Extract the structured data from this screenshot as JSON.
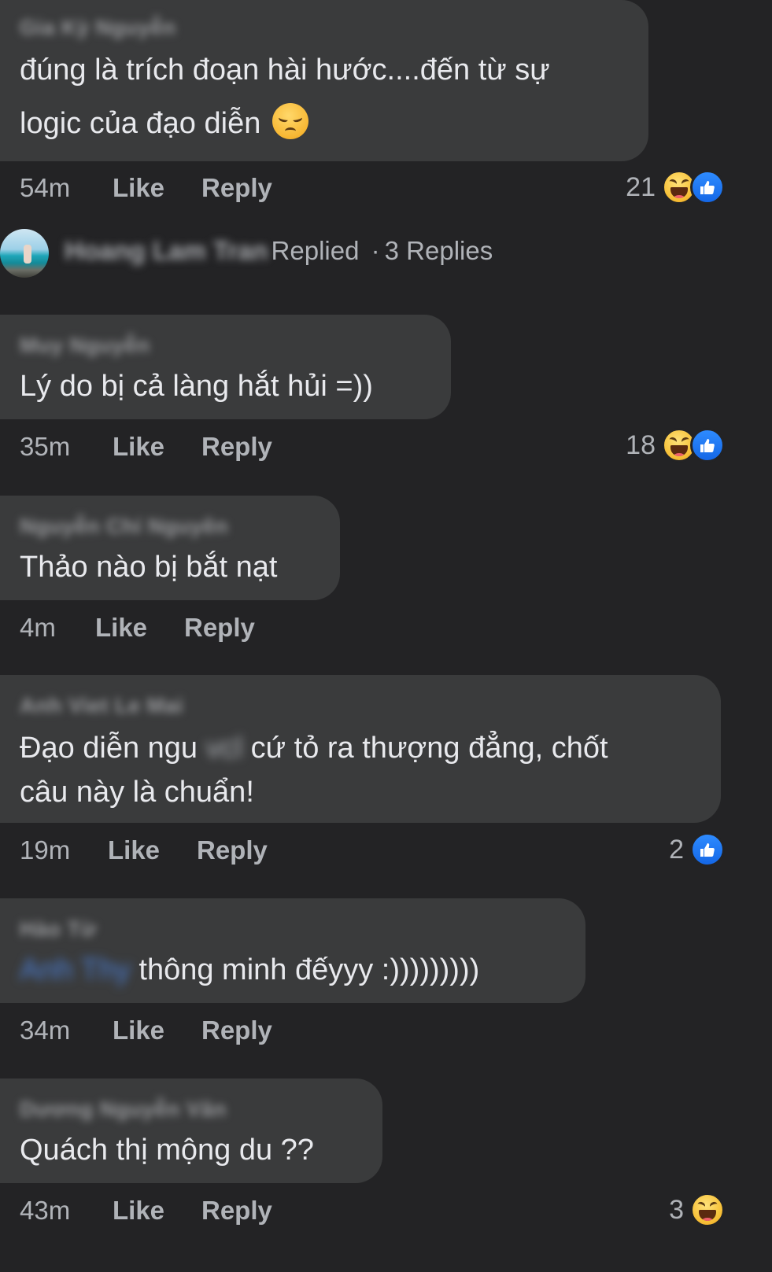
{
  "comments": [
    {
      "author": "Gia Kỳ Nguyễn",
      "lines": [
        "đúng là trích đoạn hài hước....đến từ sự",
        "logic của đạo diễn"
      ],
      "emoji": "disappointed-face-icon",
      "time": "54m",
      "like_label": "Like",
      "reply_label": "Reply",
      "reaction_count": "21",
      "reactions": [
        "haha-icon",
        "like-icon"
      ]
    },
    {
      "author": "Muy Nguyễn",
      "lines": [
        "Lý do bị cả làng hắt hủi =))"
      ],
      "time": "35m",
      "like_label": "Like",
      "reply_label": "Reply",
      "reaction_count": "18",
      "reactions": [
        "haha-icon",
        "like-icon"
      ]
    },
    {
      "author": "Nguyễn Chí Nguyên",
      "lines": [
        "Thảo nào bị bắt nạt"
      ],
      "time": "4m",
      "like_label": "Like",
      "reply_label": "Reply"
    },
    {
      "author": "Anh Viet Le Mai",
      "line1_start": "Đạo diễn ngu",
      "line1_censored": "vcl",
      "line1_end": "cứ tỏ ra thượng đẳng, chốt",
      "line2": "câu này là chuẩn!",
      "time": "19m",
      "like_label": "Like",
      "reply_label": "Reply",
      "reaction_count": "2",
      "reactions": [
        "like-icon"
      ]
    },
    {
      "author": "Hào Từ",
      "mention": "Anh Thy",
      "text": "thông minh đếyyy :)))))))))",
      "time": "34m",
      "like_label": "Like",
      "reply_label": "Reply"
    },
    {
      "author": "Dương Nguyễn Văn",
      "lines": [
        "Quách thị mộng du ??"
      ],
      "time": "43m",
      "like_label": "Like",
      "reply_label": "Reply",
      "reaction_count": "3",
      "reactions": [
        "haha-icon"
      ]
    }
  ],
  "replies_row": {
    "name": "Hoang Lam Tran",
    "replied_suffix": "Replied",
    "separator": "·",
    "replies_count_label": "3 Replies"
  }
}
